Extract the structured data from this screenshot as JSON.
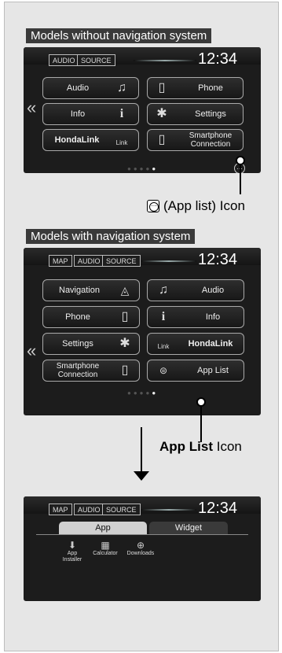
{
  "section1": {
    "label": "Models without navigation system",
    "top_buttons": [
      "AUDIO",
      "SOURCE"
    ],
    "clock": "12:34",
    "tiles_left": [
      {
        "label": "Audio",
        "icon": "music-note-icon"
      },
      {
        "label": "Info",
        "icon": "info-icon"
      },
      {
        "label": "HondaLink",
        "icon": "hondalink-icon"
      }
    ],
    "tiles_right": [
      {
        "label": "Phone",
        "icon": "phone-icon"
      },
      {
        "label": "Settings",
        "icon": "gear-icon"
      },
      {
        "label": "Smartphone\nConnection",
        "icon": "smartphone-icon"
      }
    ],
    "link_text": "Link",
    "caption": "(App list) Icon"
  },
  "section2": {
    "label": "Models with navigation system",
    "top_buttons": [
      "MAP",
      "AUDIO",
      "SOURCE"
    ],
    "clock": "12:34",
    "tiles_left": [
      {
        "label": "Navigation",
        "icon": "compass-icon"
      },
      {
        "label": "Phone",
        "icon": "phone-icon"
      },
      {
        "label": "Settings",
        "icon": "gear-icon"
      },
      {
        "label": "Smartphone\nConnection",
        "icon": "smartphone-icon"
      }
    ],
    "tiles_right": [
      {
        "label": "Audio",
        "icon": "music-note-icon"
      },
      {
        "label": "Info",
        "icon": "info-icon"
      },
      {
        "label": "HondaLink",
        "icon": "hondalink-icon"
      },
      {
        "label": "App List",
        "icon": "app-list-icon"
      }
    ],
    "link_text": "Link",
    "caption_bold": "App List",
    "caption_rest": " Icon"
  },
  "section3": {
    "top_buttons": [
      "MAP",
      "AUDIO",
      "SOURCE"
    ],
    "clock": "12:34",
    "tabs": [
      "App",
      "Widget"
    ],
    "apps": [
      {
        "label": "App\nInstaller",
        "icon": "app-installer-icon"
      },
      {
        "label": "Calculator",
        "icon": "calculator-icon"
      },
      {
        "label": "Downloads",
        "icon": "downloads-icon"
      }
    ]
  },
  "colors": {
    "panel": "#e6e6e6",
    "label_bg": "#3a3a3a",
    "screen": "#1c1c1c"
  }
}
